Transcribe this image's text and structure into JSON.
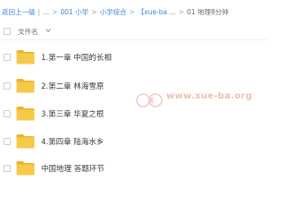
{
  "breadcrumb": {
    "back": "返回上一级",
    "items": [
      "...",
      "001 小学",
      "小学综合",
      "【xue-ba ...",
      "01 地理8分钟"
    ]
  },
  "list": {
    "header_label": "文件名",
    "sort_icon": "chevron-down-icon",
    "rows": [
      {
        "name": "1.第一章 中国的长相",
        "icon": "folder-icon"
      },
      {
        "name": "2.第二章 林海雪原",
        "icon": "folder-icon"
      },
      {
        "name": "3.第三章 华夏之根",
        "icon": "folder-icon"
      },
      {
        "name": "4.第四章 陆海水乡",
        "icon": "folder-icon"
      },
      {
        "name": "中国地理 答题环节",
        "icon": "folder-icon"
      }
    ]
  },
  "watermark": {
    "text": "www.xue-ba.org"
  },
  "colors": {
    "link": "#3b86d8",
    "folder": "#f7c948",
    "folder_dark": "#e9b429",
    "watermark": "#f0bfb3"
  }
}
